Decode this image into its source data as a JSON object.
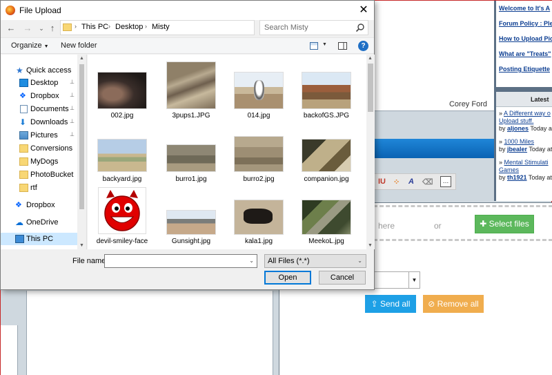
{
  "background_page": {
    "author": "Corey Ford",
    "right_links": [
      "Welcome to It's A",
      "Forum Policy : Plea",
      "How to Upload Pic",
      "What are \"Treats\"",
      "Posting Etiquette"
    ],
    "latest_header": "Latest",
    "latest_items": [
      {
        "prefix": "» ",
        "link1": "A Different way o",
        "link2": "Upload stuff.",
        "by": "by ",
        "user": "aljones",
        "time": " Today at"
      },
      {
        "prefix": "» ",
        "link1": "1000 Miles",
        "link2": "",
        "by": "by ",
        "user": "jbealer",
        "time": " Today at"
      },
      {
        "prefix": "» ",
        "link1": "Mental Stimulati",
        "link2": "Games",
        "by": "by ",
        "user": "th1921",
        "time": " Today at"
      }
    ],
    "drop_here": "here",
    "or_text": "or",
    "select_files": "✚ Select files",
    "send_all": "⇪ Send all",
    "remove_all": "⊘ Remove all"
  },
  "dialog": {
    "title": "File Upload",
    "close_glyph": "✕",
    "nav": {
      "back": "←",
      "forward": "→",
      "recent": "⌄",
      "up": "↑"
    },
    "address": {
      "crumbs": [
        "This PC",
        "Desktop",
        "Misty"
      ],
      "sep": "›",
      "dropdown": "⌄",
      "refresh": "↻"
    },
    "search_placeholder": "Search Misty",
    "toolbar": {
      "organize": "Organize",
      "new_folder": "New folder",
      "help": "?"
    },
    "nav_pane": {
      "quick_access": "Quick access",
      "items": [
        {
          "label": "Desktop",
          "icon": "desktop-icon",
          "pinned": true
        },
        {
          "label": "Dropbox",
          "icon": "dropbox-icon",
          "pinned": true
        },
        {
          "label": "Documents",
          "icon": "documents-icon",
          "pinned": true
        },
        {
          "label": "Downloads",
          "icon": "downloads-icon",
          "pinned": true
        },
        {
          "label": "Pictures",
          "icon": "pictures-icon",
          "pinned": true
        },
        {
          "label": "Conversions",
          "icon": "folder-icon",
          "pinned": false
        },
        {
          "label": "MyDogs",
          "icon": "folder-icon",
          "pinned": false
        },
        {
          "label": "PhotoBucket",
          "icon": "folder-icon",
          "pinned": false
        },
        {
          "label": "rtf",
          "icon": "folder-icon",
          "pinned": false
        }
      ],
      "dropbox": "Dropbox",
      "onedrive": "OneDrive",
      "thispc": "This PC",
      "pin_glyph": "📌"
    },
    "files": [
      "002.jpg",
      "3pups1.JPG",
      "014.jpg",
      "backofGS.JPG",
      "backyard.jpg",
      "burro1.jpg",
      "burro2.jpg",
      "companion.jpg",
      "devil-smiley-face",
      "Gunsight.jpg",
      "kala1.jpg",
      "MeekoL.jpg"
    ],
    "file_name_label": "File name:",
    "file_name_value": "",
    "file_type": "All Files (*.*)",
    "open_button": "Open",
    "cancel_button": "Cancel"
  }
}
